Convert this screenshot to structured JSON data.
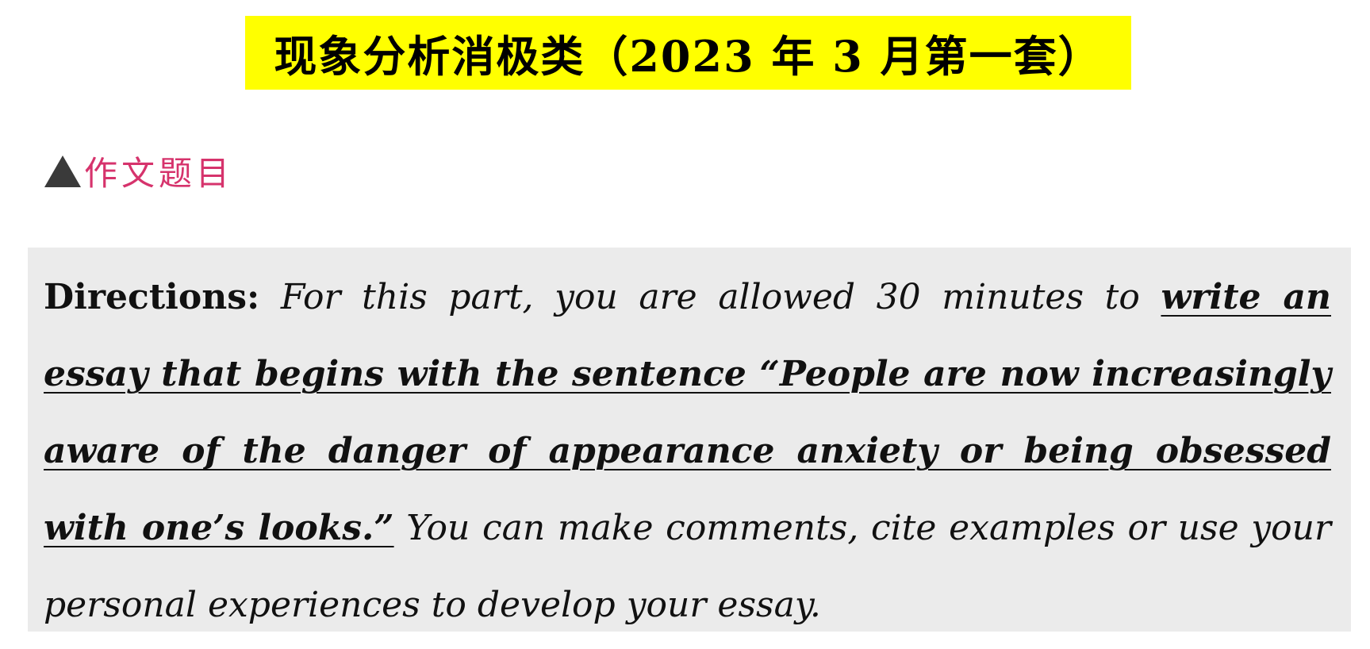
{
  "header": {
    "title": "现象分析消极类（2023 年 3 月第一套）",
    "background_color": "#ffff00"
  },
  "section": {
    "marker_icon": "triangle-up-icon",
    "label": "作文题目",
    "label_color": "#d6336c"
  },
  "directions": {
    "lead": "Directions:",
    "intro": " For this part, you are allowed 30 minutes to ",
    "emphasized": "write an essay that begins with the sentence “People are now increasingly aware of the danger of appearance anxiety or being obsessed with one’s looks.”",
    "closing": " You can make comments, cite examples or use your personal experiences to develop your essay."
  }
}
